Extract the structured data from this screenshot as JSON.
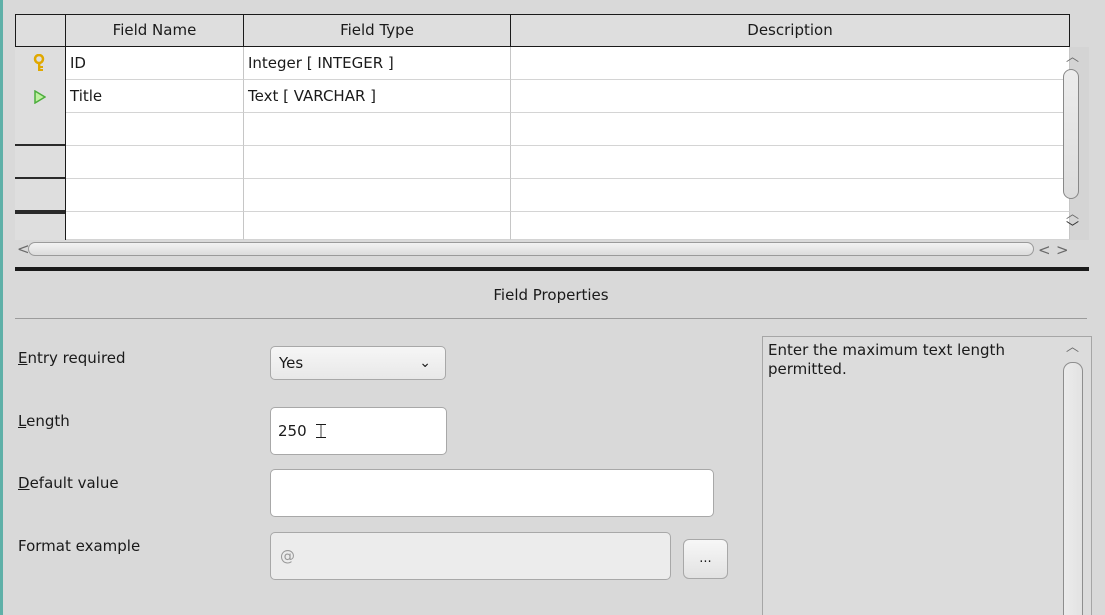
{
  "table": {
    "columns": [
      "Field Name",
      "Field Type",
      "Description"
    ],
    "rows": [
      {
        "marker": "key-icon",
        "name": "ID",
        "type": "Integer [ INTEGER ]",
        "description": ""
      },
      {
        "marker": "current-row-arrow-icon",
        "name": "Title",
        "type": "Text [ VARCHAR ]",
        "description": ""
      },
      {
        "marker": "",
        "name": "",
        "type": "",
        "description": ""
      },
      {
        "marker": "",
        "name": "",
        "type": "",
        "description": ""
      },
      {
        "marker": "",
        "name": "",
        "type": "",
        "description": ""
      },
      {
        "marker": "",
        "name": "",
        "type": "",
        "description": ""
      }
    ]
  },
  "field_properties": {
    "title": "Field Properties",
    "entry_required": {
      "label_hotkey": "E",
      "label_rest": "ntry required",
      "value": "Yes"
    },
    "length": {
      "label_hotkey": "L",
      "label_rest": "ength",
      "value": "250"
    },
    "default_value": {
      "label_hotkey": "D",
      "label_rest": "efault value",
      "value": ""
    },
    "format_example": {
      "label": "Format example",
      "value": "@",
      "button_label": "..."
    },
    "help_text": "Enter the maximum text length permitted."
  },
  "colors": {
    "key_icon": "#e0a800",
    "current_arrow": "#4cae3c",
    "window_bg": "#d9d9d9"
  }
}
